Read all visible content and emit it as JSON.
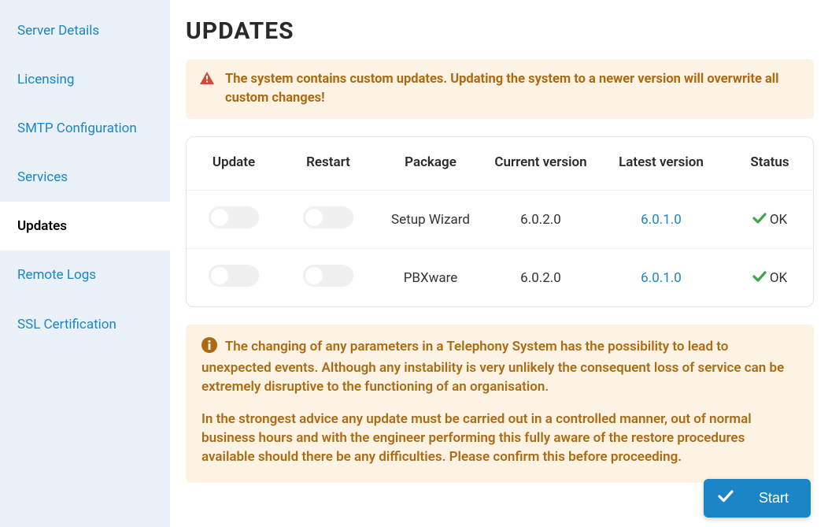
{
  "sidebar": {
    "items": [
      {
        "label": "Server Details"
      },
      {
        "label": "Licensing"
      },
      {
        "label": "SMTP Configuration"
      },
      {
        "label": "Services"
      },
      {
        "label": "Updates"
      },
      {
        "label": "Remote Logs"
      },
      {
        "label": "SSL Certification"
      }
    ],
    "active_index": 4
  },
  "page": {
    "title": "UPDATES"
  },
  "warning": {
    "text": "The system contains custom updates. Updating the system to a newer version will overwrite all custom changes!"
  },
  "table": {
    "headers": {
      "update": "Update",
      "restart": "Restart",
      "package": "Package",
      "current": "Current version",
      "latest": "Latest version",
      "status": "Status"
    },
    "rows": [
      {
        "package": "Setup Wizard",
        "current": "6.0.2.0",
        "latest": "6.0.1.0",
        "status": "OK"
      },
      {
        "package": "PBXware",
        "current": "6.0.2.0",
        "latest": "6.0.1.0",
        "status": "OK"
      }
    ]
  },
  "info": {
    "p1": "The changing of any parameters in a Telephony System has the possibility to lead to unexpected events. Although any instability is very unlikely the consequent loss of service can be extremely disruptive to the functioning of an organisation.",
    "p2": "In the strongest advice any update must be carried out in a controlled manner, out of normal business hours and with the engineer performing this fully aware of the restore procedures available should there be any difficulties. Please confirm this before proceeding."
  },
  "actions": {
    "start": "Start"
  },
  "icons": {
    "warning_triangle": "warning-triangle-icon",
    "info_circle": "info-circle-icon",
    "check": "check-icon"
  },
  "colors": {
    "accent": "#1a86c8",
    "warn_bg": "#fdf3e4",
    "warn_text": "#ac6b12",
    "ok_check": "#3fa648",
    "danger": "#d44a3a"
  }
}
